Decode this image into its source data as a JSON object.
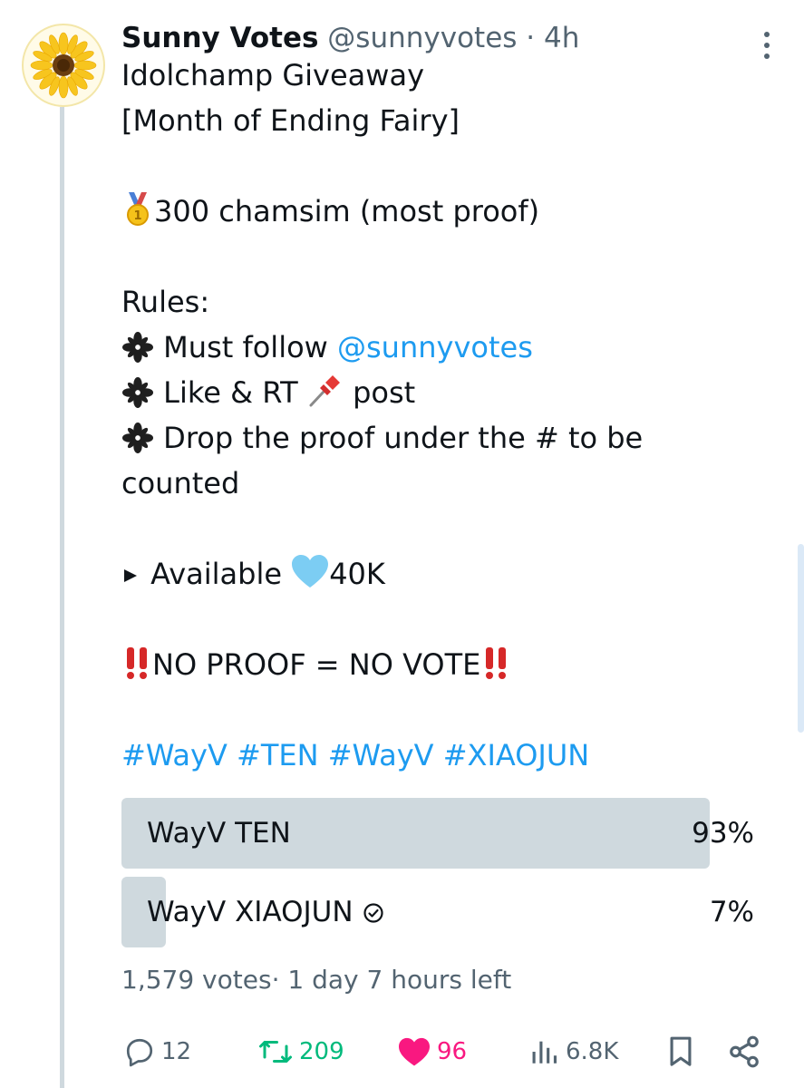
{
  "tweet": {
    "author_name": "Sunny Votes",
    "author_handle": "@sunnyvotes",
    "dot": " · ",
    "time": "4h",
    "lines": {
      "l1": "Idolchamp Giveaway",
      "l2": "[Month of Ending Fairy]",
      "prize": "300 chamsim (most proof)",
      "rules_title": "Rules:",
      "rule1_prefix": "Must follow ",
      "rule1_link": "@sunnyvotes",
      "rule2_a": "Like & RT ",
      "rule2_b": " post",
      "rule3_a": "Drop the proof under the # to be",
      "rule3_b": "counted",
      "available_prefix": "Available ",
      "available_value": "40K",
      "no_proof": "NO PROOF = NO VOTE",
      "hashtags": "#WayV #TEN #WayV #XIAOJUN"
    },
    "icons": {
      "medal": "first-place-medal-emoji",
      "rule_bullet": "four-leaf-asterisk-emoji",
      "pin": "pushpin-emoji",
      "play": "play-triangle",
      "heart_blue": "light-blue-heart-emoji",
      "double_exclamation": "double-exclamation-emoji"
    }
  },
  "poll": {
    "options": [
      {
        "label": "WayV TEN",
        "percent": "93%",
        "fraction": 0.93
      },
      {
        "label": "WayV XIAOJUN",
        "percent": "7%",
        "fraction": 0.07
      }
    ],
    "votes": "1,579 votes",
    "separator": "·",
    "time_left": " 1 day 7 hours left"
  },
  "actions": {
    "replies": "12",
    "reposts": "209",
    "likes": "96",
    "views": "6.8K"
  },
  "colors": {
    "link": "#1d9bf0",
    "repost": "#00ba7c",
    "like": "#f91880",
    "muted": "#536471",
    "poll_fill": "#cfd9de"
  }
}
